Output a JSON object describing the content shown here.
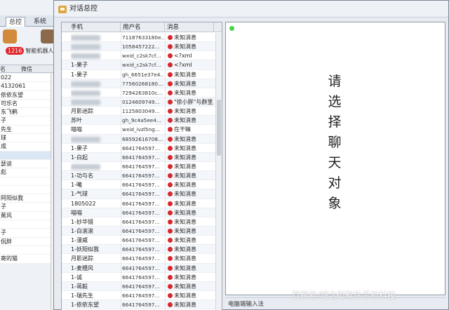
{
  "background_window": {
    "tabs": [
      "总控",
      "系统"
    ],
    "badge": "1216",
    "robot_label": "智能机器人",
    "column_header": [
      "名",
      "微信"
    ],
    "list": [
      "022",
      "4132061",
      "依依东望",
      "可乐名",
      "东飞鹤",
      "子",
      "先生",
      "球",
      "成",
      "",
      "瑟谈",
      "彪",
      "",
      "",
      "阿阳似我",
      "子",
      "蕉风",
      "",
      "子",
      "侃胖",
      "",
      "寄的猫"
    ]
  },
  "dialog": {
    "title": "对话总控",
    "table": {
      "headers": [
        "手机",
        "用户名",
        "消息"
      ],
      "rows": [
        {
          "phone": "",
          "user": "71187633180e…",
          "msg": "未知消息"
        },
        {
          "phone": "",
          "user": "1058457222…",
          "msg": "未知消息"
        },
        {
          "phone": "",
          "user": "wxid_c2sk7cf…",
          "msg": "<?xml"
        },
        {
          "phone": "1-果子",
          "user": "wxid_c2sk7cf…",
          "msg": "<?xml"
        },
        {
          "phone": "1-果子",
          "user": "gh_6651e37e4…",
          "msg": "未知消息"
        },
        {
          "phone": "",
          "user": "77560268180…",
          "msg": "未知消息"
        },
        {
          "phone": "",
          "user": "7294263810c…",
          "msg": "未知消息"
        },
        {
          "phone": "",
          "user": "0124609749…",
          "msg": "\"徐小胖\"与群里所"
        },
        {
          "phone": "月影迷踪",
          "user": "1125803049…",
          "msg": "未知消息"
        },
        {
          "phone": "苏叶",
          "user": "gh_9c4a5ee4…",
          "msg": "未知消息"
        },
        {
          "phone": "喵喵",
          "user": "wxid_ivzl5ng…",
          "msg": "在干嘛"
        },
        {
          "phone": "",
          "user": "68592616708…",
          "msg": "未知消息"
        },
        {
          "phone": "1-果子",
          "user": "6641764597…",
          "msg": "未知消息"
        },
        {
          "phone": "1-白起",
          "user": "6641764597…",
          "msg": "未知消息"
        },
        {
          "phone": "",
          "user": "6641764597…",
          "msg": "未知消息"
        },
        {
          "phone": "1-功与名",
          "user": "6641764597…",
          "msg": "未知消息"
        },
        {
          "phone": "1-曦",
          "user": "6641764597…",
          "msg": "未知消息"
        },
        {
          "phone": "1-气球",
          "user": "6641764597…",
          "msg": "未知消息"
        },
        {
          "phone": "1805022",
          "user": "6641764597…",
          "msg": "未知消息"
        },
        {
          "phone": "喵喵",
          "user": "6641764597…",
          "msg": "未知消息"
        },
        {
          "phone": "1-妙华镜",
          "user": "6641764597…",
          "msg": "未知消息"
        },
        {
          "phone": "1-白滚滚",
          "user": "6641764597…",
          "msg": "未知消息"
        },
        {
          "phone": "1-漫威",
          "user": "6641764597…",
          "msg": "未知消息"
        },
        {
          "phone": "1-妖阳似我",
          "user": "6641764597…",
          "msg": "未知消息"
        },
        {
          "phone": "月影迷踪",
          "user": "6641764597…",
          "msg": "未知消息"
        },
        {
          "phone": "1-麦穗风",
          "user": "6641764597…",
          "msg": "未知消息"
        },
        {
          "phone": "1-诚",
          "user": "6641764597…",
          "msg": "未知消息"
        },
        {
          "phone": "1-蒋毅",
          "user": "6641764597…",
          "msg": "未知消息"
        },
        {
          "phone": "1-瑞先生",
          "user": "6641764597…",
          "msg": "未知消息"
        },
        {
          "phone": "1-依依东望",
          "user": "6641764597…",
          "msg": "未知消息"
        }
      ]
    },
    "chat_prompt": [
      "请",
      "选",
      "择",
      "聊",
      "天",
      "对",
      "象"
    ],
    "footer_label": "电脑端输入法"
  },
  "watermark": "百家号/城之街软件手机科技",
  "colors": {
    "unread_dot": "#d8262b",
    "online_dot": "#45d34a",
    "badge": "#e0262c"
  }
}
